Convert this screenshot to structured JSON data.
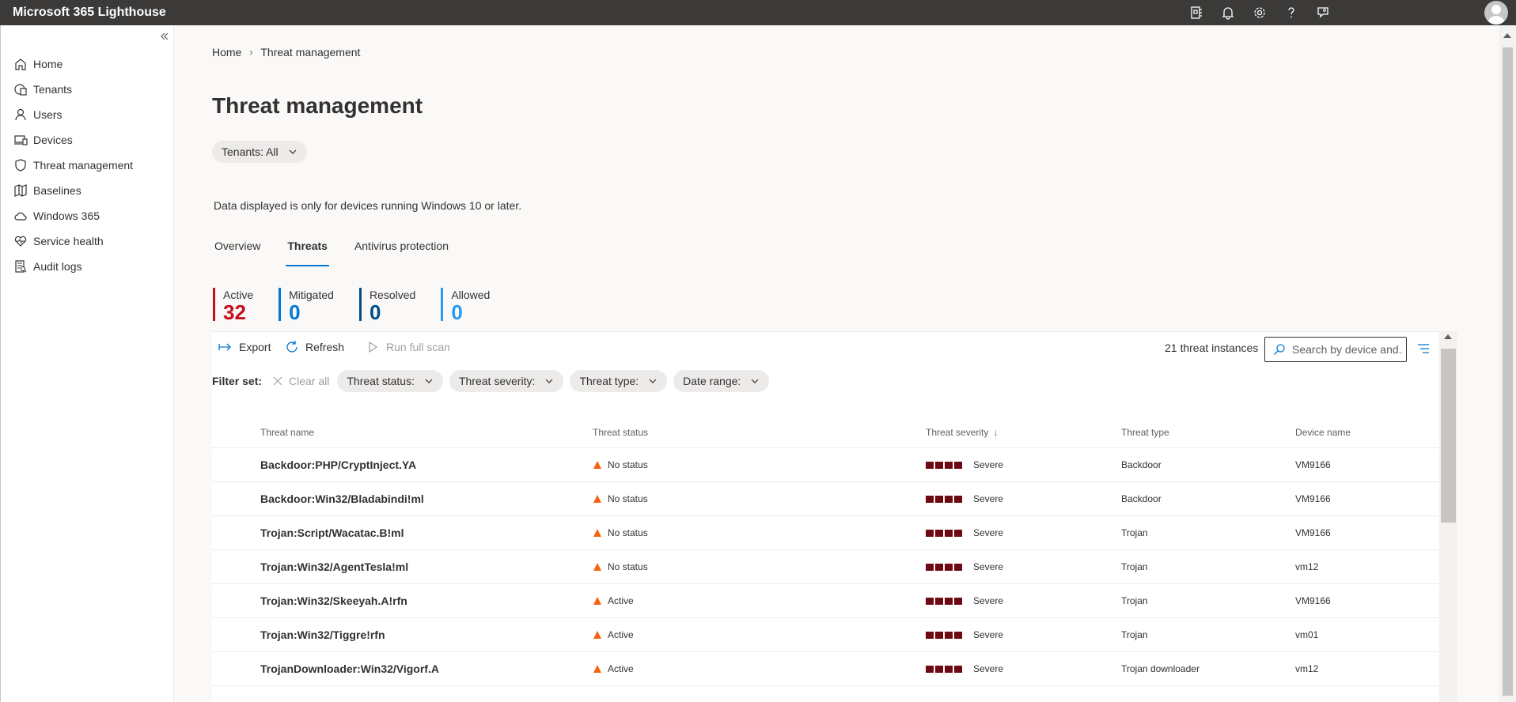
{
  "app": {
    "title": "Microsoft 365 Lighthouse"
  },
  "topbar": {
    "icons": [
      "app-launcher-icon",
      "bell-icon",
      "gear-icon",
      "help-icon",
      "feedback-icon"
    ],
    "avatar": "avatar"
  },
  "sidebar": {
    "items": [
      {
        "label": "Home",
        "icon": "home-icon"
      },
      {
        "label": "Tenants",
        "icon": "tenants-icon"
      },
      {
        "label": "Users",
        "icon": "user-icon"
      },
      {
        "label": "Devices",
        "icon": "devices-icon"
      },
      {
        "label": "Threat management",
        "icon": "shield-icon"
      },
      {
        "label": "Baselines",
        "icon": "map-icon"
      },
      {
        "label": "Windows 365",
        "icon": "cloud-icon"
      },
      {
        "label": "Service health",
        "icon": "heart-icon"
      },
      {
        "label": "Audit logs",
        "icon": "audit-log-icon"
      }
    ]
  },
  "breadcrumb": {
    "home": "Home",
    "current": "Threat management"
  },
  "page": {
    "title": "Threat management",
    "tenants_filter": "Tenants: All",
    "info": "Data displayed is only for devices running Windows 10 or later."
  },
  "tabs": [
    {
      "label": "Overview",
      "active": false
    },
    {
      "label": "Threats",
      "active": true
    },
    {
      "label": "Antivirus protection",
      "active": false
    }
  ],
  "stats": [
    {
      "label": "Active",
      "value": "32",
      "color": "#c50f1f"
    },
    {
      "label": "Mitigated",
      "value": "0",
      "color": "#0078d4"
    },
    {
      "label": "Resolved",
      "value": "0",
      "color": "#004e8c"
    },
    {
      "label": "Allowed",
      "value": "0",
      "color": "#2899f5"
    }
  ],
  "toolbar": {
    "export": "Export",
    "refresh": "Refresh",
    "run_scan": "Run full scan",
    "instances": "21 threat instances",
    "search_placeholder": "Search by device and..."
  },
  "filters": {
    "label": "Filter set:",
    "clear_all": "Clear all",
    "items": [
      "Threat status:",
      "Threat severity:",
      "Threat type:",
      "Date range:"
    ]
  },
  "table": {
    "headers": {
      "name": "Threat name",
      "status": "Threat status",
      "severity": "Threat severity",
      "type": "Threat type",
      "device": "Device name"
    },
    "rows": [
      {
        "name": "Backdoor:PHP/CryptInject.YA",
        "status": "No status",
        "severity": "Severe",
        "type": "Backdoor",
        "device": "VM9166"
      },
      {
        "name": "Backdoor:Win32/Bladabindi!ml",
        "status": "No status",
        "severity": "Severe",
        "type": "Backdoor",
        "device": "VM9166"
      },
      {
        "name": "Trojan:Script/Wacatac.B!ml",
        "status": "No status",
        "severity": "Severe",
        "type": "Trojan",
        "device": "VM9166"
      },
      {
        "name": "Trojan:Win32/AgentTesla!ml",
        "status": "No status",
        "severity": "Severe",
        "type": "Trojan",
        "device": "vm12"
      },
      {
        "name": "Trojan:Win32/Skeeyah.A!rfn",
        "status": "Active",
        "severity": "Severe",
        "type": "Trojan",
        "device": "VM9166"
      },
      {
        "name": "Trojan:Win32/Tiggre!rfn",
        "status": "Active",
        "severity": "Severe",
        "type": "Trojan",
        "device": "vm01"
      },
      {
        "name": "TrojanDownloader:Win32/Vigorf.A",
        "status": "Active",
        "severity": "Severe",
        "type": "Trojan downloader",
        "device": "vm12"
      }
    ]
  }
}
